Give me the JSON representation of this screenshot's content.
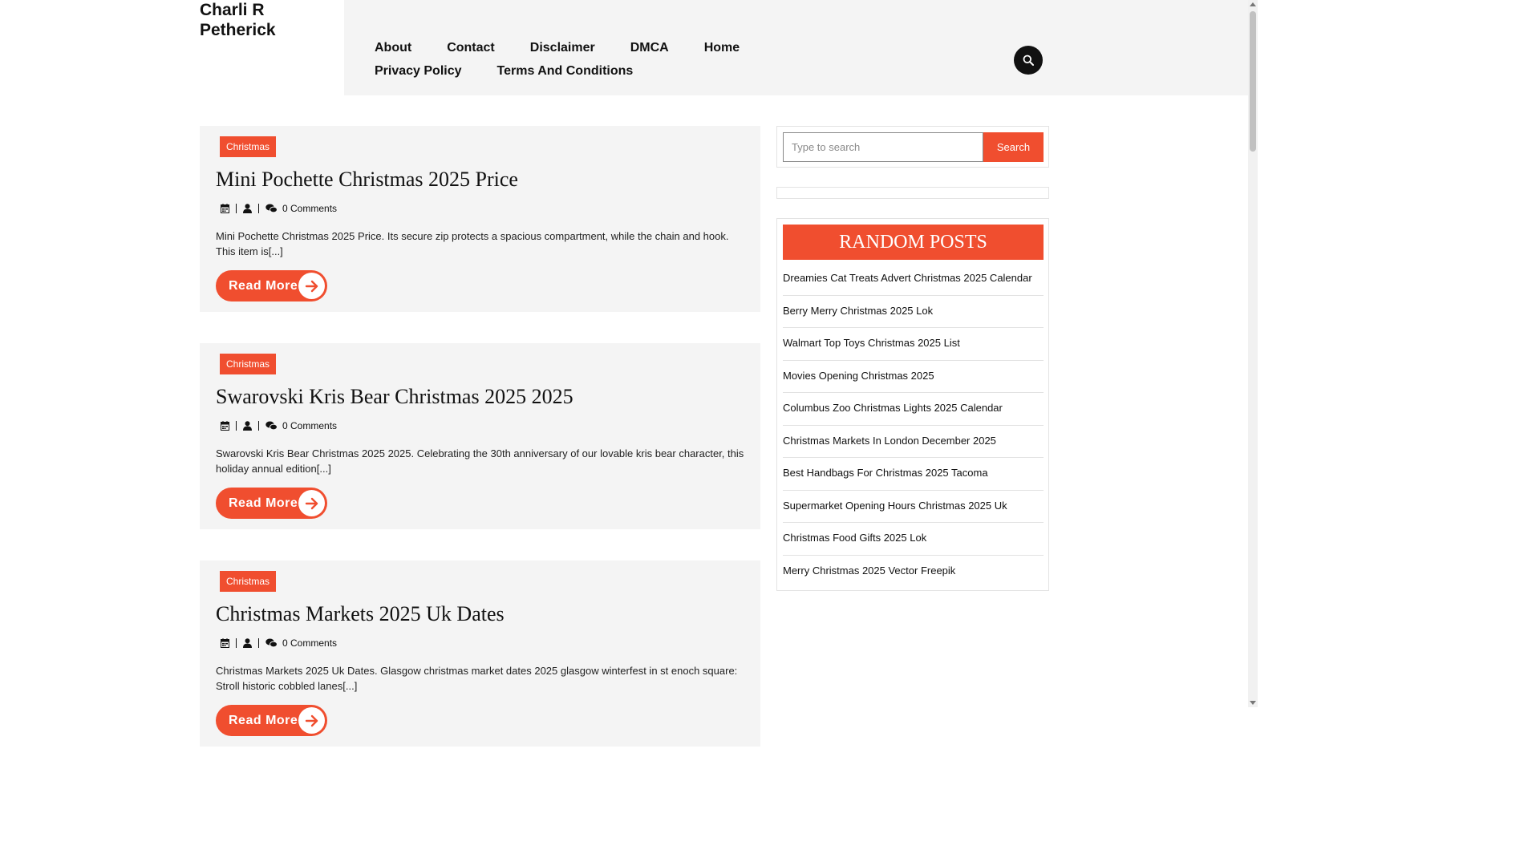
{
  "site": {
    "title": "Charli R Petherick"
  },
  "nav": {
    "items": [
      "About",
      "Contact",
      "Disclaimer",
      "DMCA",
      "Home",
      "Privacy Policy",
      "Terms And Conditions"
    ]
  },
  "posts": [
    {
      "category": "Christmas",
      "title": "Mini Pochette Christmas 2025 Price",
      "comments": "0 Comments",
      "excerpt": "Mini Pochette Christmas 2025 Price. Its secure zip protects a spacious compartment, while the chain and hook. This item is[...]",
      "read_more": "Read More"
    },
    {
      "category": "Christmas",
      "title": "Swarovski Kris Bear Christmas 2025 2025",
      "comments": "0 Comments",
      "excerpt": "Swarovski Kris Bear Christmas 2025 2025. Celebrating the 30th anniversary of our lovable kris bear character, this holiday annual edition[...]",
      "read_more": "Read More"
    },
    {
      "category": "Christmas",
      "title": "Christmas Markets 2025 Uk Dates",
      "comments": "0 Comments",
      "excerpt": "Christmas Markets 2025 Uk Dates. Glasgow christmas market dates 2025 glasgow winterfest in st enoch square: Stroll historic cobbled lanes[...]",
      "read_more": "Read More"
    }
  ],
  "sidebar": {
    "search": {
      "placeholder": "Type to search",
      "button": "Search"
    },
    "random_posts": {
      "title": "RANDOM POSTS",
      "items": [
        "Dreamies Cat Treats Advert Christmas 2025 Calendar",
        "Berry Merry Christmas 2025 Lok",
        "Walmart Top Toys Christmas 2025 List",
        "Movies Opening Christmas 2025",
        "Columbus Zoo Christmas Lights 2025 Calendar",
        "Christmas Markets In London December 2025",
        "Best Handbags For Christmas 2025 Tacoma",
        "Supermarket Opening Hours Christmas 2025 Uk",
        "Christmas Food Gifts 2025 Lok",
        "Merry Christmas 2025 Vector Freepik"
      ]
    }
  },
  "colors": {
    "accent": "#f04e2f",
    "header_bg": "#f4f4f4",
    "text": "#111111"
  },
  "icons": {
    "search": "search-icon",
    "calendar": "calendar-icon",
    "user": "user-icon",
    "comments": "comments-icon",
    "arrow": "arrow-right-icon"
  }
}
